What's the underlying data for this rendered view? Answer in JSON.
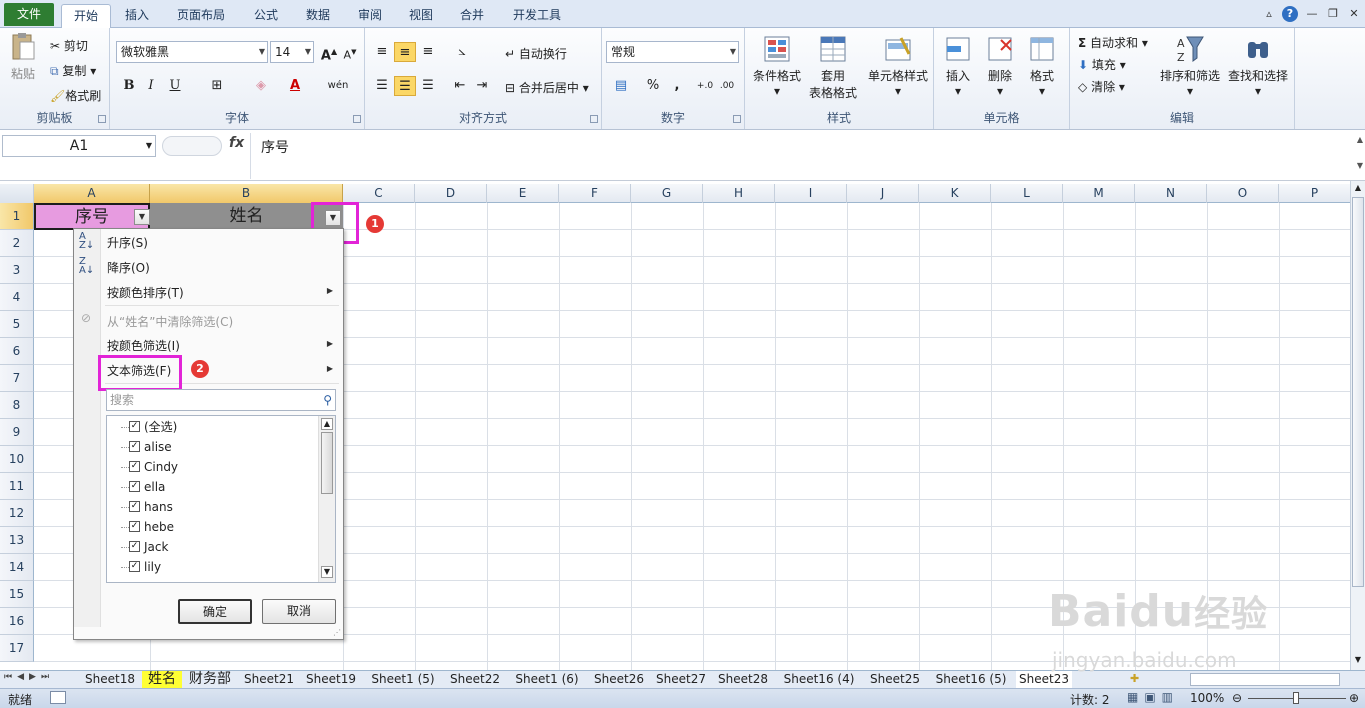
{
  "ribbon_tabs": [
    "文件",
    "开始",
    "插入",
    "页面布局",
    "公式",
    "数据",
    "审阅",
    "视图",
    "合并",
    "开发工具"
  ],
  "clipboard": {
    "paste": "粘贴",
    "cut": "剪切",
    "copy": "复制",
    "format_painter": "格式刷",
    "label": "剪贴板"
  },
  "font": {
    "name": "微软雅黑",
    "size": "14",
    "label": "字体",
    "bold": "B",
    "italic": "I",
    "underline": "U",
    "wen": "wén",
    "font_color_glyph": "A",
    "size_up": "A",
    "size_down": "A"
  },
  "alignment": {
    "wrap": "自动换行",
    "merge": "合并后居中",
    "label": "对齐方式"
  },
  "number": {
    "format": "常规",
    "percent": "%",
    "comma": ",",
    "label": "数字"
  },
  "styles": {
    "cond_format": "条件格式",
    "table_format_1": "套用",
    "table_format_2": "表格格式",
    "cell_styles": "单元格样式",
    "label": "样式"
  },
  "cells": {
    "insert": "插入",
    "delete": "删除",
    "format": "格式",
    "label": "单元格"
  },
  "editing": {
    "autosum": "自动求和",
    "fill": "填充",
    "clear": "清除",
    "sort_filter": "排序和筛选",
    "find_select": "查找和选择",
    "label": "编辑"
  },
  "formula_bar": {
    "name_box": "A1",
    "fx": "fx",
    "content": "序号"
  },
  "columns": [
    "A",
    "B",
    "C",
    "D",
    "E",
    "F",
    "G",
    "H",
    "I",
    "J",
    "K",
    "L",
    "M",
    "N",
    "O",
    "P"
  ],
  "rows": [
    "1",
    "2",
    "3",
    "4",
    "5",
    "6",
    "7",
    "8",
    "9",
    "10",
    "11",
    "12",
    "13",
    "14",
    "15",
    "16",
    "17"
  ],
  "cells_data": {
    "A1": "序号",
    "B1": "姓名"
  },
  "callouts": {
    "one": "1",
    "two": "2"
  },
  "filter_menu": {
    "sort_asc": "升序(S)",
    "sort_desc": "降序(O)",
    "sort_color": "按颜色排序(T)",
    "clear_filter": "从“姓名”中清除筛选(C)",
    "filter_color": "按颜色筛选(I)",
    "text_filter": "文本筛选(F)",
    "search_placeholder": "搜索",
    "items": [
      "(全选)",
      "alise",
      "Cindy",
      "ella",
      "hans",
      "hebe",
      "Jack",
      "lily"
    ],
    "ok": "确定",
    "cancel": "取消"
  },
  "sheet_tabs": [
    "Sheet18",
    "姓名",
    "财务部",
    "Sheet21",
    "Sheet19",
    "Sheet1 (5)",
    "Sheet22",
    "Sheet1 (6)",
    "Sheet26",
    "Sheet27",
    "Sheet28",
    "Sheet16 (4)",
    "Sheet25",
    "Sheet16 (5)",
    "Sheet23"
  ],
  "active_sheet": "Sheet23",
  "status": {
    "ready": "就绪",
    "count": "计数: 2",
    "zoom": "100%"
  },
  "watermark": {
    "brand": "Baidu",
    "jy": "经验",
    "url": "jingyan.baidu.com"
  }
}
